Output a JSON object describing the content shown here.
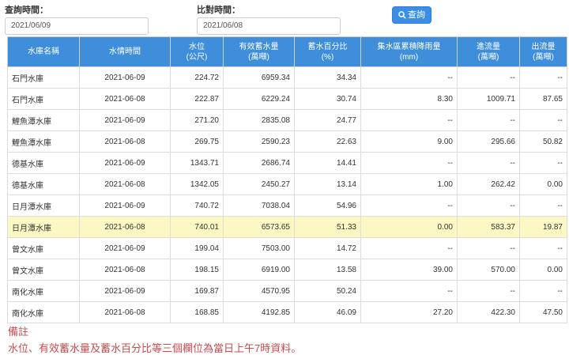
{
  "query": {
    "query_time_label": "查詢時間：",
    "query_time_value": "2021/06/09",
    "compare_time_label": "比對時間：",
    "compare_time_value": "2021/06/08",
    "search_button_label": "查詢"
  },
  "table": {
    "headers": [
      [
        "水庫名稱"
      ],
      [
        "水情時間"
      ],
      [
        "水位",
        "(公尺)"
      ],
      [
        "有效蓄水量",
        "(萬噸)"
      ],
      [
        "蓄水百分比",
        "(%)"
      ],
      [
        "集水區累積降雨量",
        "(mm)"
      ],
      [
        "進流量",
        "(萬噸)"
      ],
      [
        "出流量",
        "(萬噸)"
      ]
    ],
    "rows": [
      [
        "石門水庫",
        "2021-06-09",
        "224.72",
        "6959.34",
        "34.34",
        "--",
        "--",
        "--"
      ],
      [
        "石門水庫",
        "2021-06-08",
        "222.87",
        "6229.24",
        "30.74",
        "8.30",
        "1009.71",
        "87.65"
      ],
      [
        "鯉魚潭水庫",
        "2021-06-09",
        "271.20",
        "2835.08",
        "24.77",
        "--",
        "--",
        "--"
      ],
      [
        "鯉魚潭水庫",
        "2021-06-08",
        "269.75",
        "2590.23",
        "22.63",
        "9.00",
        "295.66",
        "50.82"
      ],
      [
        "德基水庫",
        "2021-06-09",
        "1343.71",
        "2686.74",
        "14.41",
        "--",
        "--",
        "--"
      ],
      [
        "德基水庫",
        "2021-06-08",
        "1342.05",
        "2450.27",
        "13.14",
        "1.00",
        "262.42",
        "0.00"
      ],
      [
        "日月潭水庫",
        "2021-06-09",
        "740.72",
        "7038.04",
        "54.96",
        "--",
        "--",
        "--"
      ],
      [
        "日月潭水庫",
        "2021-06-08",
        "740.01",
        "6573.65",
        "51.33",
        "0.00",
        "583.37",
        "19.87"
      ],
      [
        "曾文水庫",
        "2021-06-09",
        "199.04",
        "7503.00",
        "14.72",
        "--",
        "--",
        "--"
      ],
      [
        "曾文水庫",
        "2021-06-08",
        "198.15",
        "6919.00",
        "13.58",
        "39.00",
        "570.00",
        "0.00"
      ],
      [
        "南化水庫",
        "2021-06-09",
        "169.87",
        "4570.95",
        "50.24",
        "--",
        "--",
        "--"
      ],
      [
        "南化水庫",
        "2021-06-08",
        "168.85",
        "4192.85",
        "46.09",
        "27.20",
        "422.30",
        "47.50"
      ]
    ],
    "highlight_row_index": 7,
    "header_color": "#3e8edc",
    "highlight_color": "#fcf8c4"
  },
  "note": {
    "title": "備註",
    "text": "水位、有效蓄水量及蓄水百分比等三個欄位為當日上午7時資料。",
    "color": "#c0504d"
  }
}
